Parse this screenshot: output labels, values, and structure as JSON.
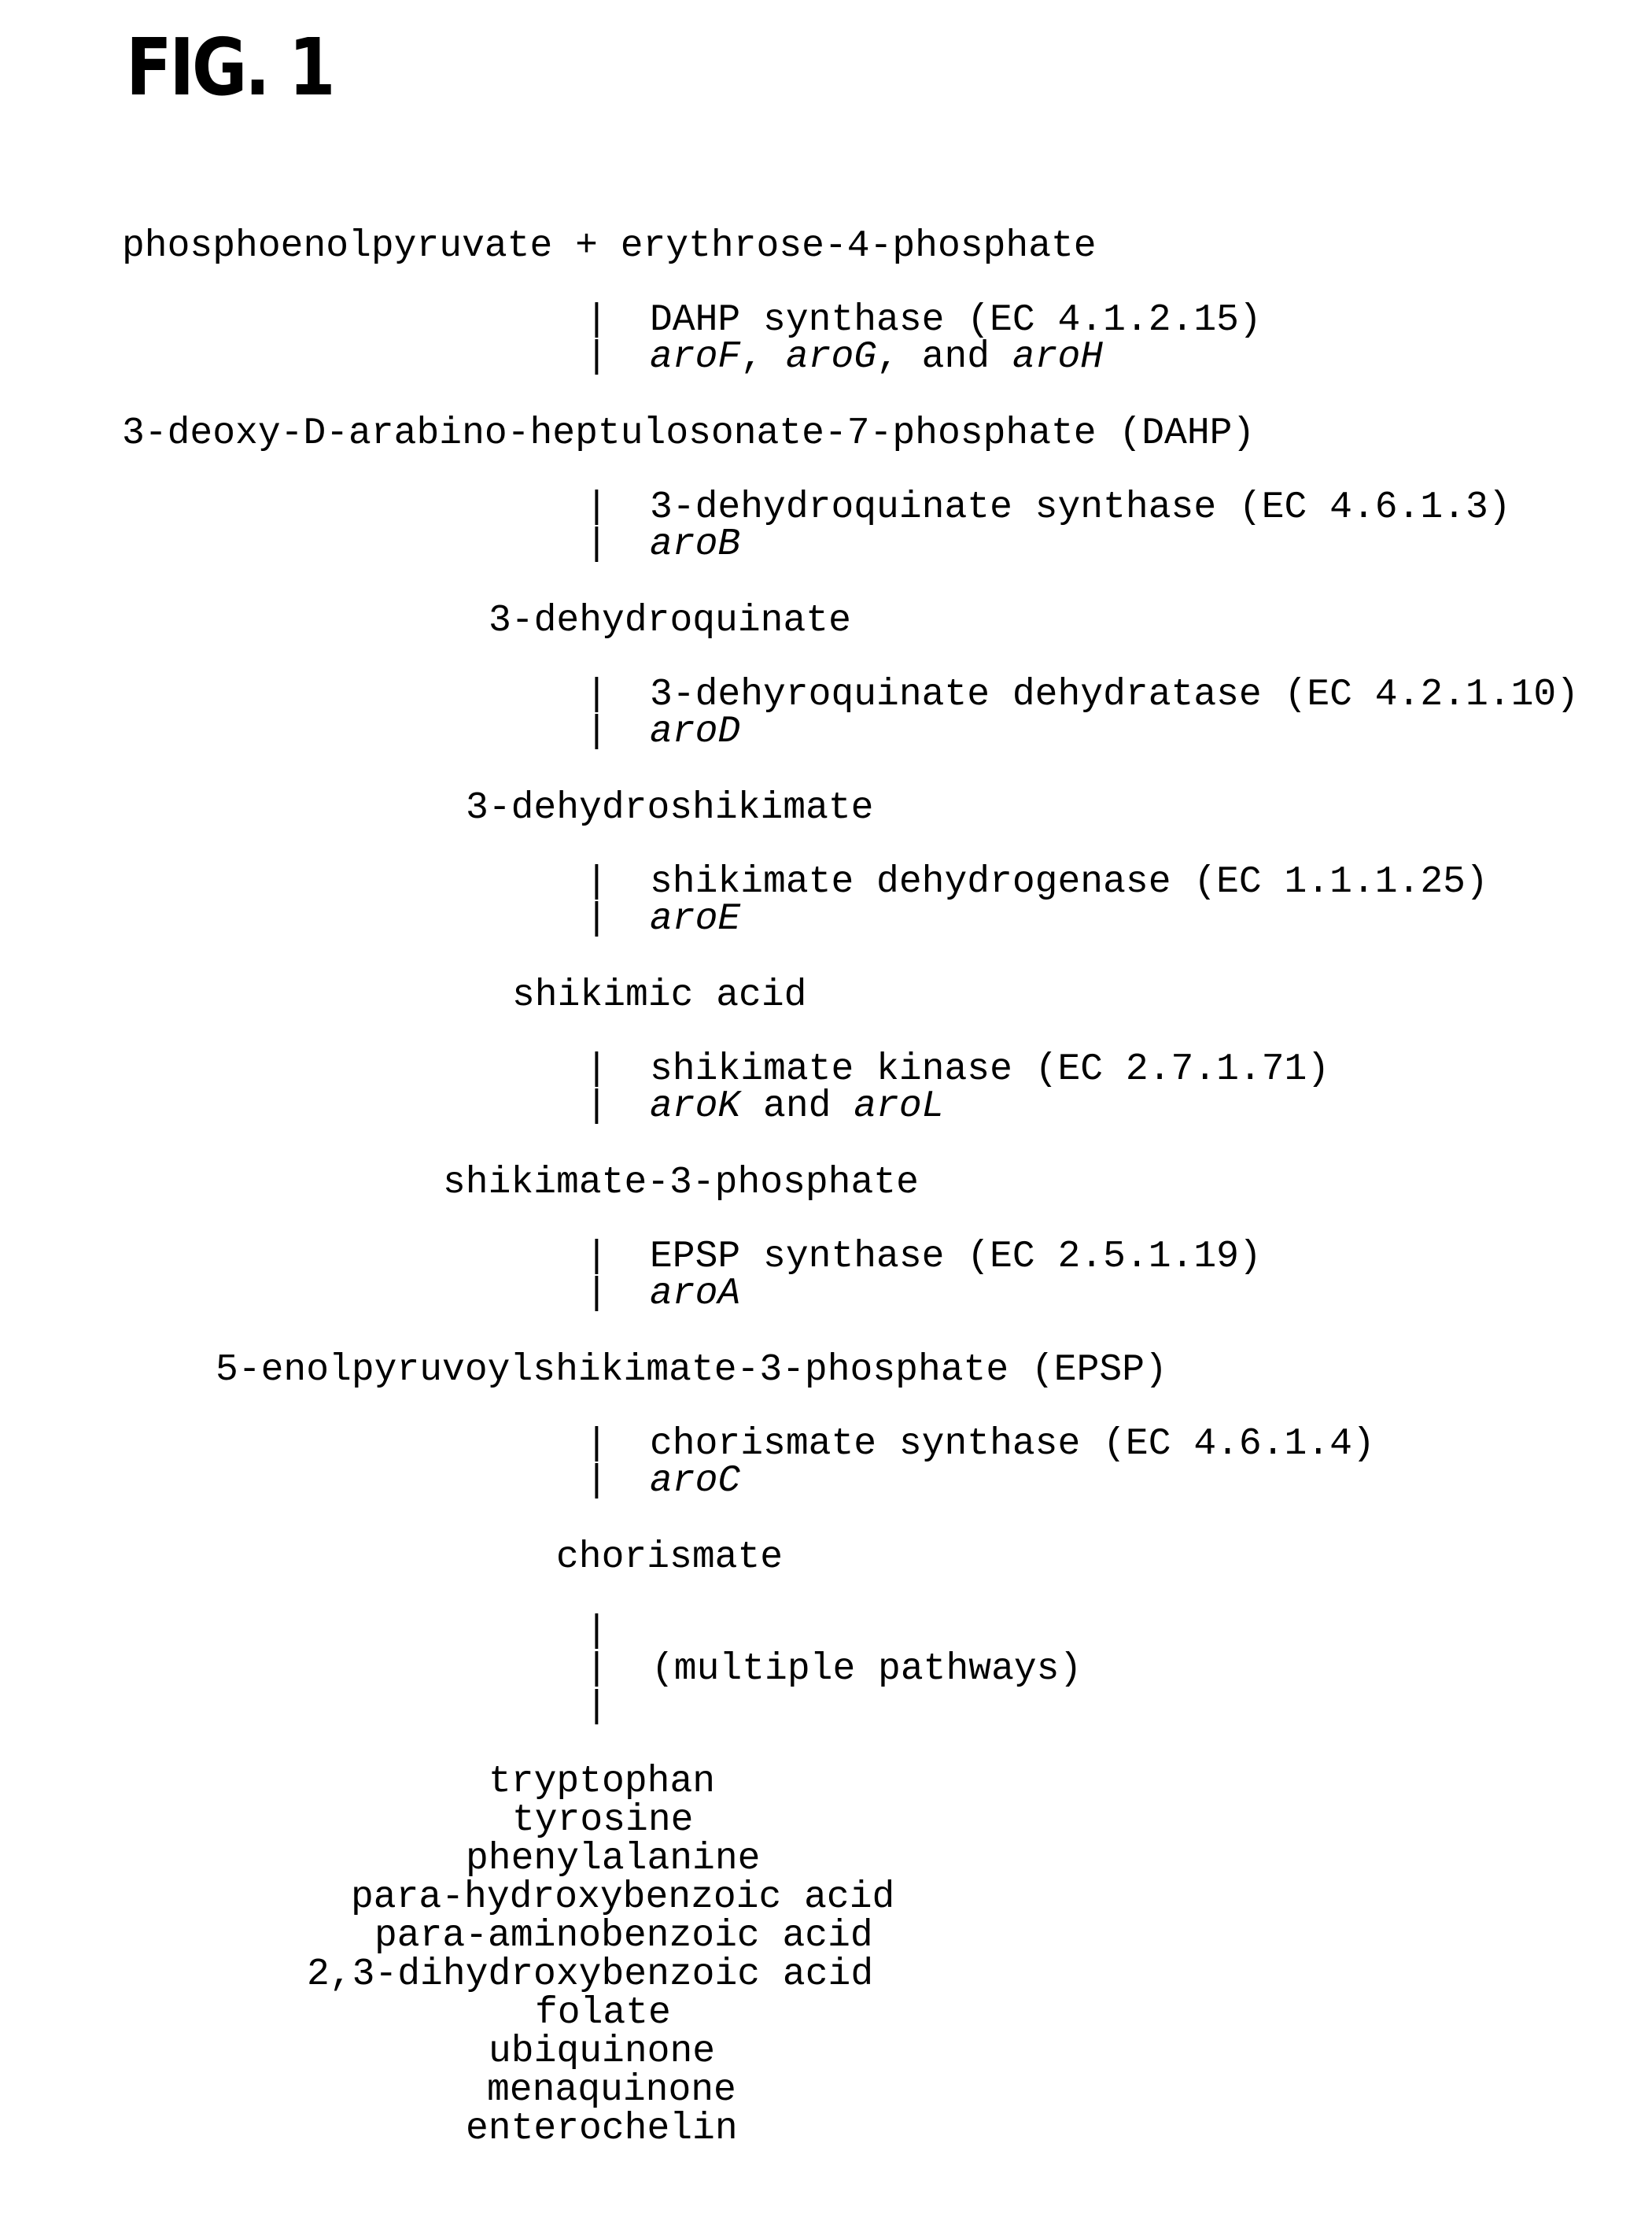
{
  "figure": {
    "title": "FIG. 1"
  },
  "pathway": {
    "arrow_glyph": "|",
    "metabolites": [
      "phosphoenolpyruvate + erythrose-4-phosphate",
      "3-deoxy-D-arabino-heptulosonate-7-phosphate (DAHP)",
      "3-dehydroquinate",
      "3-dehydroshikimate",
      "shikimic acid",
      "shikimate-3-phosphate",
      "5-enolpyruvoylshikimate-3-phosphate (EPSP)",
      "chorismate"
    ],
    "steps": [
      {
        "enzyme": "DAHP synthase (EC 4.1.2.15)",
        "genes": [
          {
            "text": "aroF",
            "italic": true
          },
          {
            "text": ", ",
            "italic": false
          },
          {
            "text": "aroG",
            "italic": true
          },
          {
            "text": ", and ",
            "italic": false
          },
          {
            "text": "aroH",
            "italic": true
          }
        ]
      },
      {
        "enzyme": "3-dehydroquinate synthase (EC 4.6.1.3)",
        "genes": [
          {
            "text": "aroB",
            "italic": true
          }
        ]
      },
      {
        "enzyme": "3-dehyroquinate dehydratase (EC 4.2.1.10)",
        "genes": [
          {
            "text": "aroD",
            "italic": true
          }
        ]
      },
      {
        "enzyme": "shikimate dehydrogenase (EC 1.1.1.25)",
        "genes": [
          {
            "text": "aroE",
            "italic": true
          }
        ]
      },
      {
        "enzyme": "shikimate kinase (EC 2.7.1.71)",
        "genes": [
          {
            "text": "aroK",
            "italic": true
          },
          {
            "text": " and ",
            "italic": false
          },
          {
            "text": "aroL",
            "italic": true
          }
        ]
      },
      {
        "enzyme": "EPSP synthase (EC 2.5.1.19)",
        "genes": [
          {
            "text": "aroA",
            "italic": true
          }
        ]
      },
      {
        "enzyme": "chorismate synthase (EC 4.6.1.4)",
        "genes": [
          {
            "text": "aroC",
            "italic": true
          }
        ]
      }
    ],
    "final_step": {
      "label": "(multiple pathways)"
    },
    "products": [
      "tryptophan",
      "tyrosine",
      "phenylalanine",
      "para-hydroxybenzoic acid",
      "para-aminobenzoic acid",
      "2,3-dihydroxybenzoic acid",
      "folate",
      "ubiquinone",
      "menaquinone",
      "enterochelin"
    ]
  }
}
